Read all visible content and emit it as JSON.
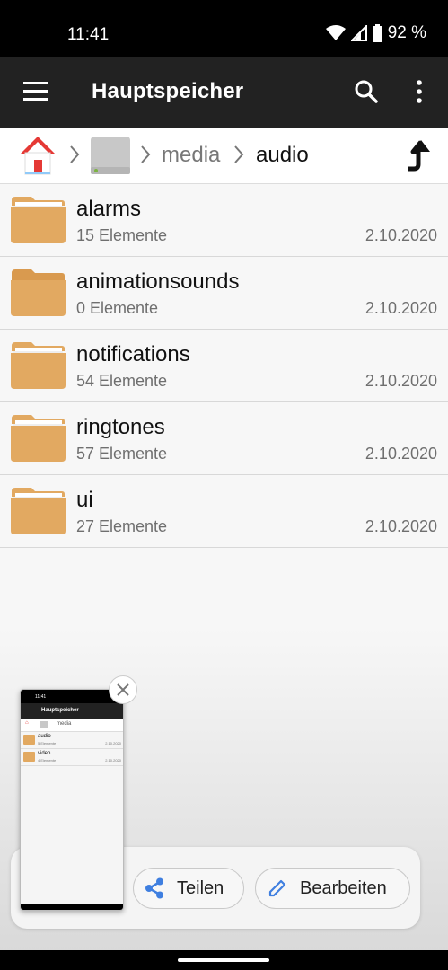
{
  "status_bar": {
    "time": "11:41",
    "battery": "92 %"
  },
  "app_bar": {
    "title": "Hauptspeicher",
    "icons": [
      "menu-icon",
      "search-icon",
      "more-vert-icon"
    ]
  },
  "breadcrumb": {
    "items": [
      "media",
      "audio"
    ],
    "icons": [
      "home-icon",
      "drive-icon",
      "up-arrow-icon"
    ]
  },
  "folders": [
    {
      "name": "alarms",
      "count": "15 Elemente",
      "date": "2.10.2020"
    },
    {
      "name": "animationsounds",
      "count": "0 Elemente",
      "date": "2.10.2020"
    },
    {
      "name": "notifications",
      "count": "54 Elemente",
      "date": "2.10.2020"
    },
    {
      "name": "ringtones",
      "count": "57 Elemente",
      "date": "2.10.2020"
    },
    {
      "name": "ui",
      "count": "27 Elemente",
      "date": "2.10.2020"
    }
  ],
  "screenshot_preview": {
    "time": "11:41",
    "title": "Hauptspeicher",
    "breadcrumb": "media",
    "rows": [
      {
        "name": "audio",
        "count": "5 Elemente",
        "date": "2.10.2020"
      },
      {
        "name": "video",
        "count": "4 Elemente",
        "date": "2.10.2020"
      }
    ]
  },
  "actions": {
    "share": "Teilen",
    "edit": "Bearbeiten"
  },
  "colors": {
    "folder": "#e2a961",
    "app_bar": "#222222",
    "accent_blue": "#3f7fe0",
    "home_red": "#e53935"
  }
}
